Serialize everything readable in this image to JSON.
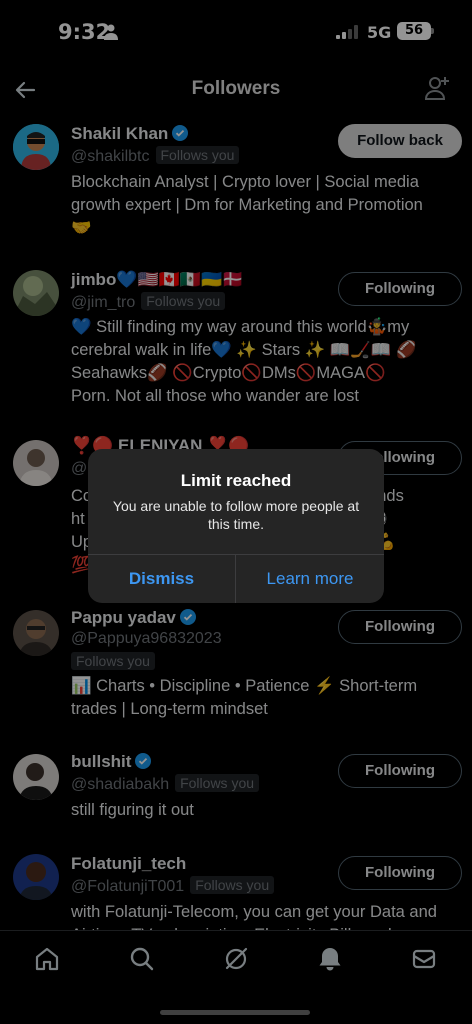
{
  "status_bar": {
    "time": "9:32",
    "network": "5G",
    "battery": "56"
  },
  "header": {
    "title": "Followers"
  },
  "followers": [
    {
      "name": "Shakil Khan",
      "handle": "@shakilbtc",
      "follows_you": "Follows you",
      "button": "Follow back",
      "bio": [
        "Blockchain Analyst | Crypto lover | Social media",
        "growth expert | Dm for Marketing and Promotion",
        "🤝"
      ]
    },
    {
      "name": "jimbo💙🇺🇸🇨🇦🇲🇽🇺🇦🇩🇰",
      "handle": "@jim_tro",
      "follows_you": "Follows you",
      "button": "Following",
      "bio": [
        "💙 Still finding my way around this world🤹my",
        "cerebral walk in life💙 ✨ Stars ✨ 📖🏒📖 🏈",
        "Seahawks🏈 🚫Crypto🚫DMs🚫MAGA🚫",
        "Porn. Not all those who wander are lost"
      ]
    },
    {
      "name": "❣️🔴 ELENIYAN ❣️🔴",
      "handle": "@",
      "button": "Following",
      "bio": [
        "Co                                                      t, brands",
        "ht                                                     otball⚽",
        "Up                                                     nited 💪",
        "💯"
      ]
    },
    {
      "name": "Pappu yadav",
      "handle": "@Pappuya96832023",
      "follows_you": "Follows you",
      "button": "Following",
      "bio": [
        "📊 Charts • Discipline • Patience ⚡ Short-term",
        "trades | Long-term mindset"
      ]
    },
    {
      "name": "bullshit",
      "handle": "@shadiabakh",
      "follows_you": "Follows you",
      "button": "Following",
      "bio": [
        "still figuring it out"
      ]
    },
    {
      "name": "Folatunji_tech",
      "handle": "@FolatunjiT001",
      "follows_you": "Follows you",
      "button": "Following",
      "bio": [
        "with Folatunji-Telecom, you can get your Data and",
        "Airtime, TV subscription, Electricity Bills and co"
      ]
    }
  ],
  "dialog": {
    "title": "Limit reached",
    "message": "You are unable to follow more people at this time.",
    "dismiss": "Dismiss",
    "learn_more": "Learn more"
  },
  "colors": {
    "accent": "#1d9bf0",
    "dialog_link": "#3d97f2",
    "muted": "#71767b"
  },
  "icons": [
    "back-arrow-icon",
    "add-person-icon",
    "verified-badge-icon",
    "home-icon",
    "search-icon",
    "grok-icon",
    "notifications-icon",
    "messages-icon"
  ]
}
